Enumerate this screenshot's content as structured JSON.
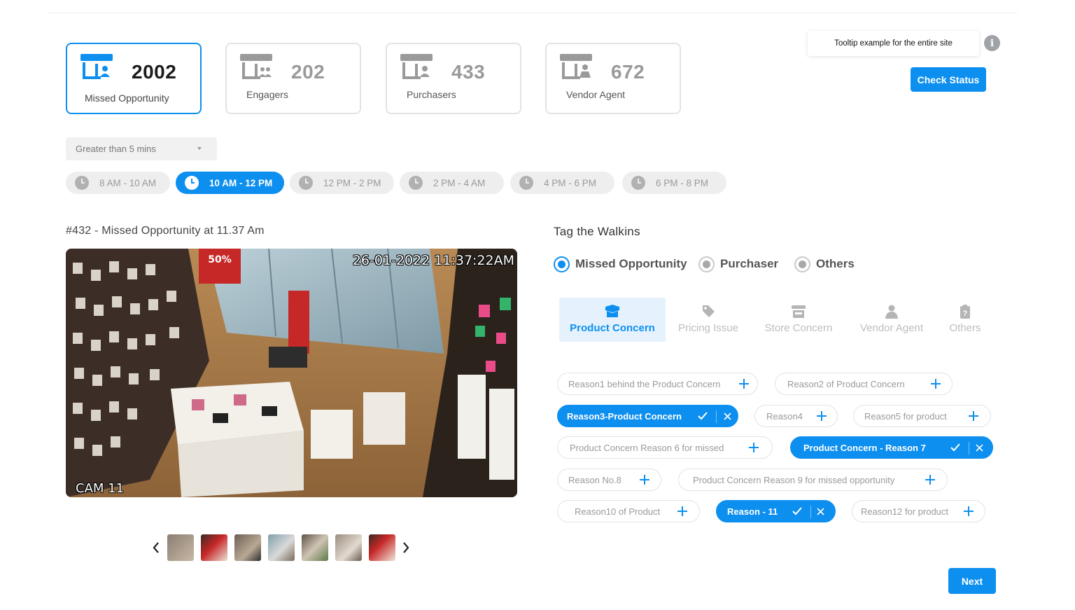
{
  "stats": [
    {
      "value": "2002",
      "label": "Missed Opportunity",
      "active": true,
      "icon": "store-person-icon"
    },
    {
      "value": "202",
      "label": "Engagers",
      "active": false,
      "icon": "store-group-icon"
    },
    {
      "value": "433",
      "label": "Purchasers",
      "active": false,
      "icon": "store-person-icon"
    },
    {
      "value": "672",
      "label": "Vendor Agent",
      "active": false,
      "icon": "store-agent-icon"
    }
  ],
  "tooltip": {
    "text": "Tooltip example for the entire site",
    "icon": "info-icon"
  },
  "check_status_label": "Check Status",
  "duration_filter": {
    "selected": "Greater than 5 mins"
  },
  "time_slots": [
    {
      "label": "8 AM - 10 AM",
      "active": false
    },
    {
      "label": "10 AM - 12 PM",
      "active": true
    },
    {
      "label": "12 PM - 2 PM",
      "active": false
    },
    {
      "label": "2 PM - 4 AM",
      "active": false
    },
    {
      "label": "4 PM - 6 PM",
      "active": false
    },
    {
      "label": "6 PM - 8 PM",
      "active": false
    }
  ],
  "video": {
    "title": "#432 - Missed Opportunity at 11.37 Am",
    "timestamp": "26-01-2022 11:37:22AM",
    "camera": "CAM 11",
    "sale_sign": "50%"
  },
  "thumbnail_count": 7,
  "tag": {
    "title": "Tag the Walkins",
    "options": [
      {
        "label": "Missed Opportunity",
        "checked": true
      },
      {
        "label": "Purchaser",
        "checked": false
      },
      {
        "label": "Others",
        "checked": false
      }
    ]
  },
  "categories": [
    {
      "label": "Product Concern",
      "icon": "box-icon",
      "active": true
    },
    {
      "label": "Pricing Issue",
      "icon": "price-tag-icon",
      "active": false
    },
    {
      "label": "Store Concern",
      "icon": "store-icon",
      "active": false
    },
    {
      "label": "Vendor Agent",
      "icon": "person-icon",
      "active": false
    },
    {
      "label": "Others",
      "icon": "clipboard-question-icon",
      "active": false
    }
  ],
  "reasons": [
    {
      "label": "Reason1 behind the Product Concern",
      "selected": false
    },
    {
      "label": "Reason2 of Product Concern",
      "selected": false
    },
    {
      "label": "Reason3-Product Concern",
      "selected": true
    },
    {
      "label": "Reason4",
      "selected": false
    },
    {
      "label": "Reason5 for product",
      "selected": false
    },
    {
      "label": "Product Concern Reason 6 for missed",
      "selected": false
    },
    {
      "label": "Product Concern - Reason 7",
      "selected": true
    },
    {
      "label": "Reason No.8",
      "selected": false
    },
    {
      "label": "Product Concern Reason 9 for missed opportunity",
      "selected": false
    },
    {
      "label": "Reason10 of Product",
      "selected": false
    },
    {
      "label": "Reason - 11",
      "selected": true
    },
    {
      "label": "Reason12 for product",
      "selected": false
    }
  ],
  "next_label": "Next",
  "colors": {
    "accent": "#0d8ff0",
    "muted": "#9a9a9a",
    "pill_bg": "#eeeeee"
  }
}
